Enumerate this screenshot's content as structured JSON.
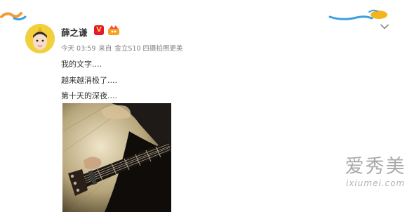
{
  "post": {
    "username": "薛之谦",
    "verified_badge": "V",
    "verified_icon": "verified-v-icon",
    "member_icon": "member-crown-icon",
    "more_icon": "chevron-down-icon",
    "meta": {
      "time": "今天 03:59",
      "source_prefix": "来自",
      "source": "金立S10 四摄拍照更美"
    },
    "text_lines": [
      "我的文字....",
      "越来越消极了....",
      "第十天的深夜...."
    ],
    "image": "guitar-photo"
  },
  "watermark": {
    "chinese": "爱秀美",
    "latin": "ixiumei.com"
  },
  "colors": {
    "username": "#333333",
    "meta": "#808080",
    "verified": "#e6162d",
    "avatar_bg": "#f2cf3c",
    "watermark": "#a9a9a9"
  }
}
